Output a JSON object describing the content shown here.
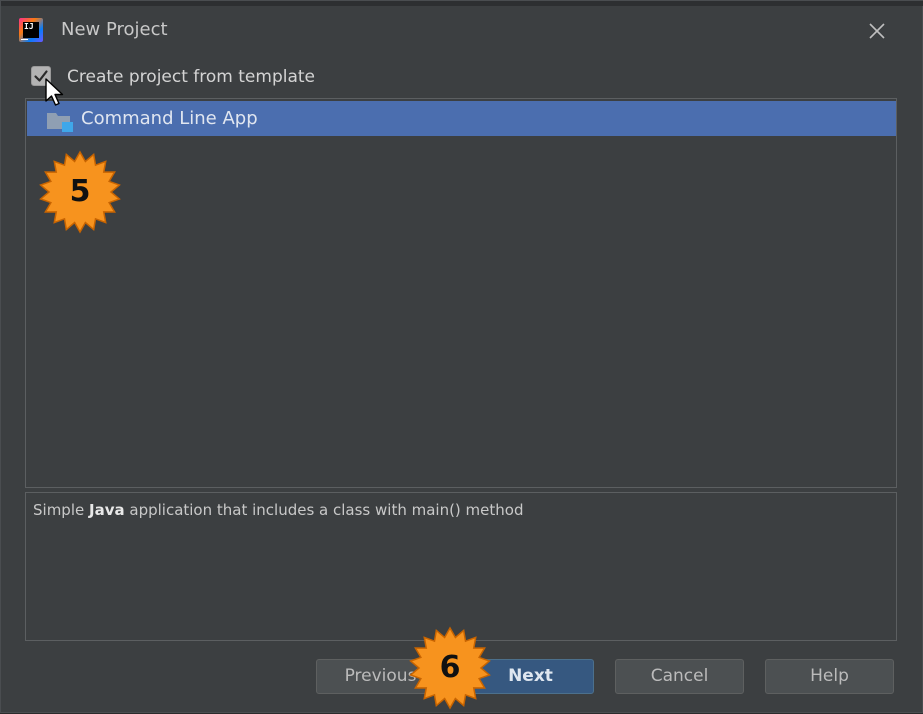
{
  "window": {
    "title": "New Project",
    "close_glyph": "✕",
    "logo_text": "IJ",
    "logo_icon": "intellij-idea-icon"
  },
  "template": {
    "label": "Create project from template",
    "checked": true
  },
  "templates_list": {
    "items": [
      {
        "label": "Command Line App",
        "selected": true,
        "icon": "folder-icon"
      }
    ]
  },
  "description": {
    "prefix": "Simple ",
    "bold": "Java",
    "suffix": " application that includes a class with main() method"
  },
  "buttons": {
    "previous": "Previous",
    "next": "Next",
    "cancel": "Cancel",
    "help": "Help"
  },
  "annotations": [
    {
      "number": "5"
    },
    {
      "number": "6"
    }
  ],
  "colors": {
    "dialog_background": "#3c3f41",
    "selection": "#4b6eaf",
    "primary_button": "#365880",
    "starburst_fill": "#f7931e",
    "starburst_stroke": "#c86400"
  }
}
